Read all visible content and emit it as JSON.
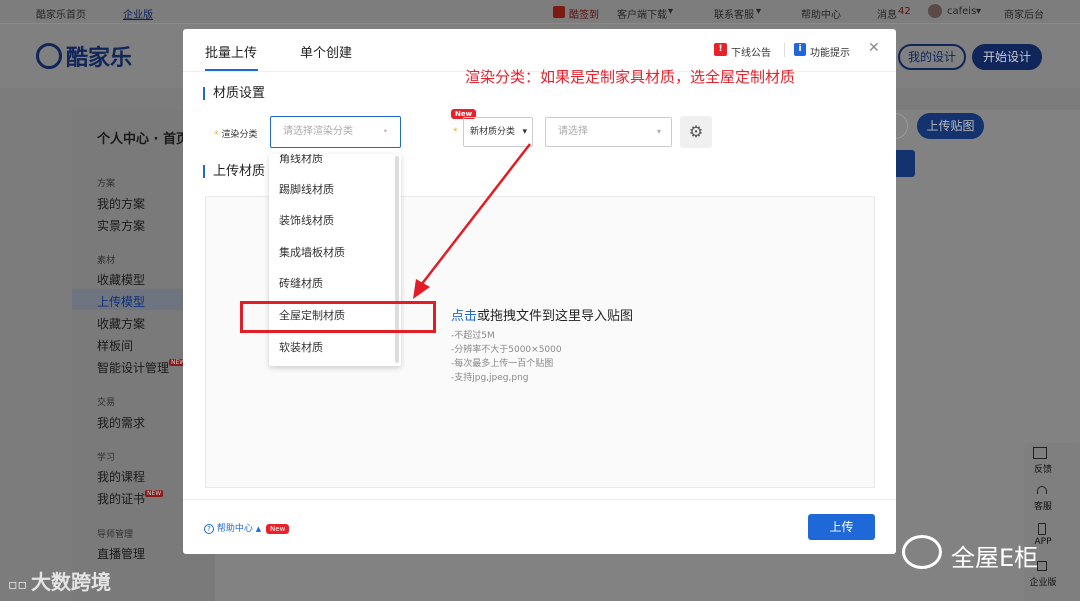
{
  "topbar": {
    "home_link": "酷家乐首页",
    "edition": "企业版",
    "checkin": "酷签到",
    "client_download": "客户端下载",
    "contact": "联系客服",
    "help": "帮助中心",
    "messages_label": "消息",
    "messages_count": "42",
    "username": "cafeis",
    "merchant": "商家后台"
  },
  "header": {
    "logo_text": "酷家乐",
    "my_design": "我的设计",
    "start_design": "开始设计"
  },
  "sidebar": {
    "title": "个人中心 · 首页",
    "groups": [
      {
        "label": "方案",
        "items": [
          "我的方案",
          "实景方案"
        ]
      },
      {
        "label": "素材",
        "items": [
          "收藏模型",
          "上传模型",
          "收藏方案",
          "样板间",
          "智能设计管理"
        ]
      },
      {
        "label": "交易",
        "items": [
          "我的需求"
        ]
      },
      {
        "label": "学习",
        "items": [
          "我的课程",
          "我的证书"
        ]
      },
      {
        "label": "导师管理",
        "items": [
          "直播管理"
        ]
      }
    ],
    "new_badge": "NEW"
  },
  "main": {
    "upload_texture_btn": "上传贴图"
  },
  "right_tools": [
    "反馈",
    "客服",
    "APP",
    "企业版"
  ],
  "modal": {
    "tabs": [
      "批量上传",
      "单个创建"
    ],
    "offline_notice": "下线公告",
    "feature_tips": "功能提示",
    "annotation": "渲染分类：如果是定制家具材质，选全屋定制材质",
    "section_material": "材质设置",
    "render_label": "渲染分类",
    "render_placeholder": "请选择渲染分类",
    "new_badge": "New",
    "new_category_label": "新材质分类",
    "category_placeholder": "请选择",
    "dropdown_options": [
      "角线材质",
      "踢脚线材质",
      "装饰线材质",
      "集成墙板材质",
      "砖缝材质",
      "全屋定制材质",
      "软装材质"
    ],
    "section_upload": "上传材质",
    "upload_click": "点击",
    "upload_text": "或拖拽文件到这里导入贴图",
    "hints": [
      "-不超过5M",
      "-分辨率不大于5000×5000",
      "-每次最多上传一百个贴图",
      "-支持jpg,jpeg,png"
    ],
    "help_center": "帮助中心",
    "upload_button": "上传"
  },
  "watermarks": {
    "left": "大数跨境",
    "right": "全屋E柜"
  },
  "colors": {
    "primary": "#1e68d8",
    "annotation_red": "#e8212b",
    "overlay": "#7c7c7c"
  }
}
